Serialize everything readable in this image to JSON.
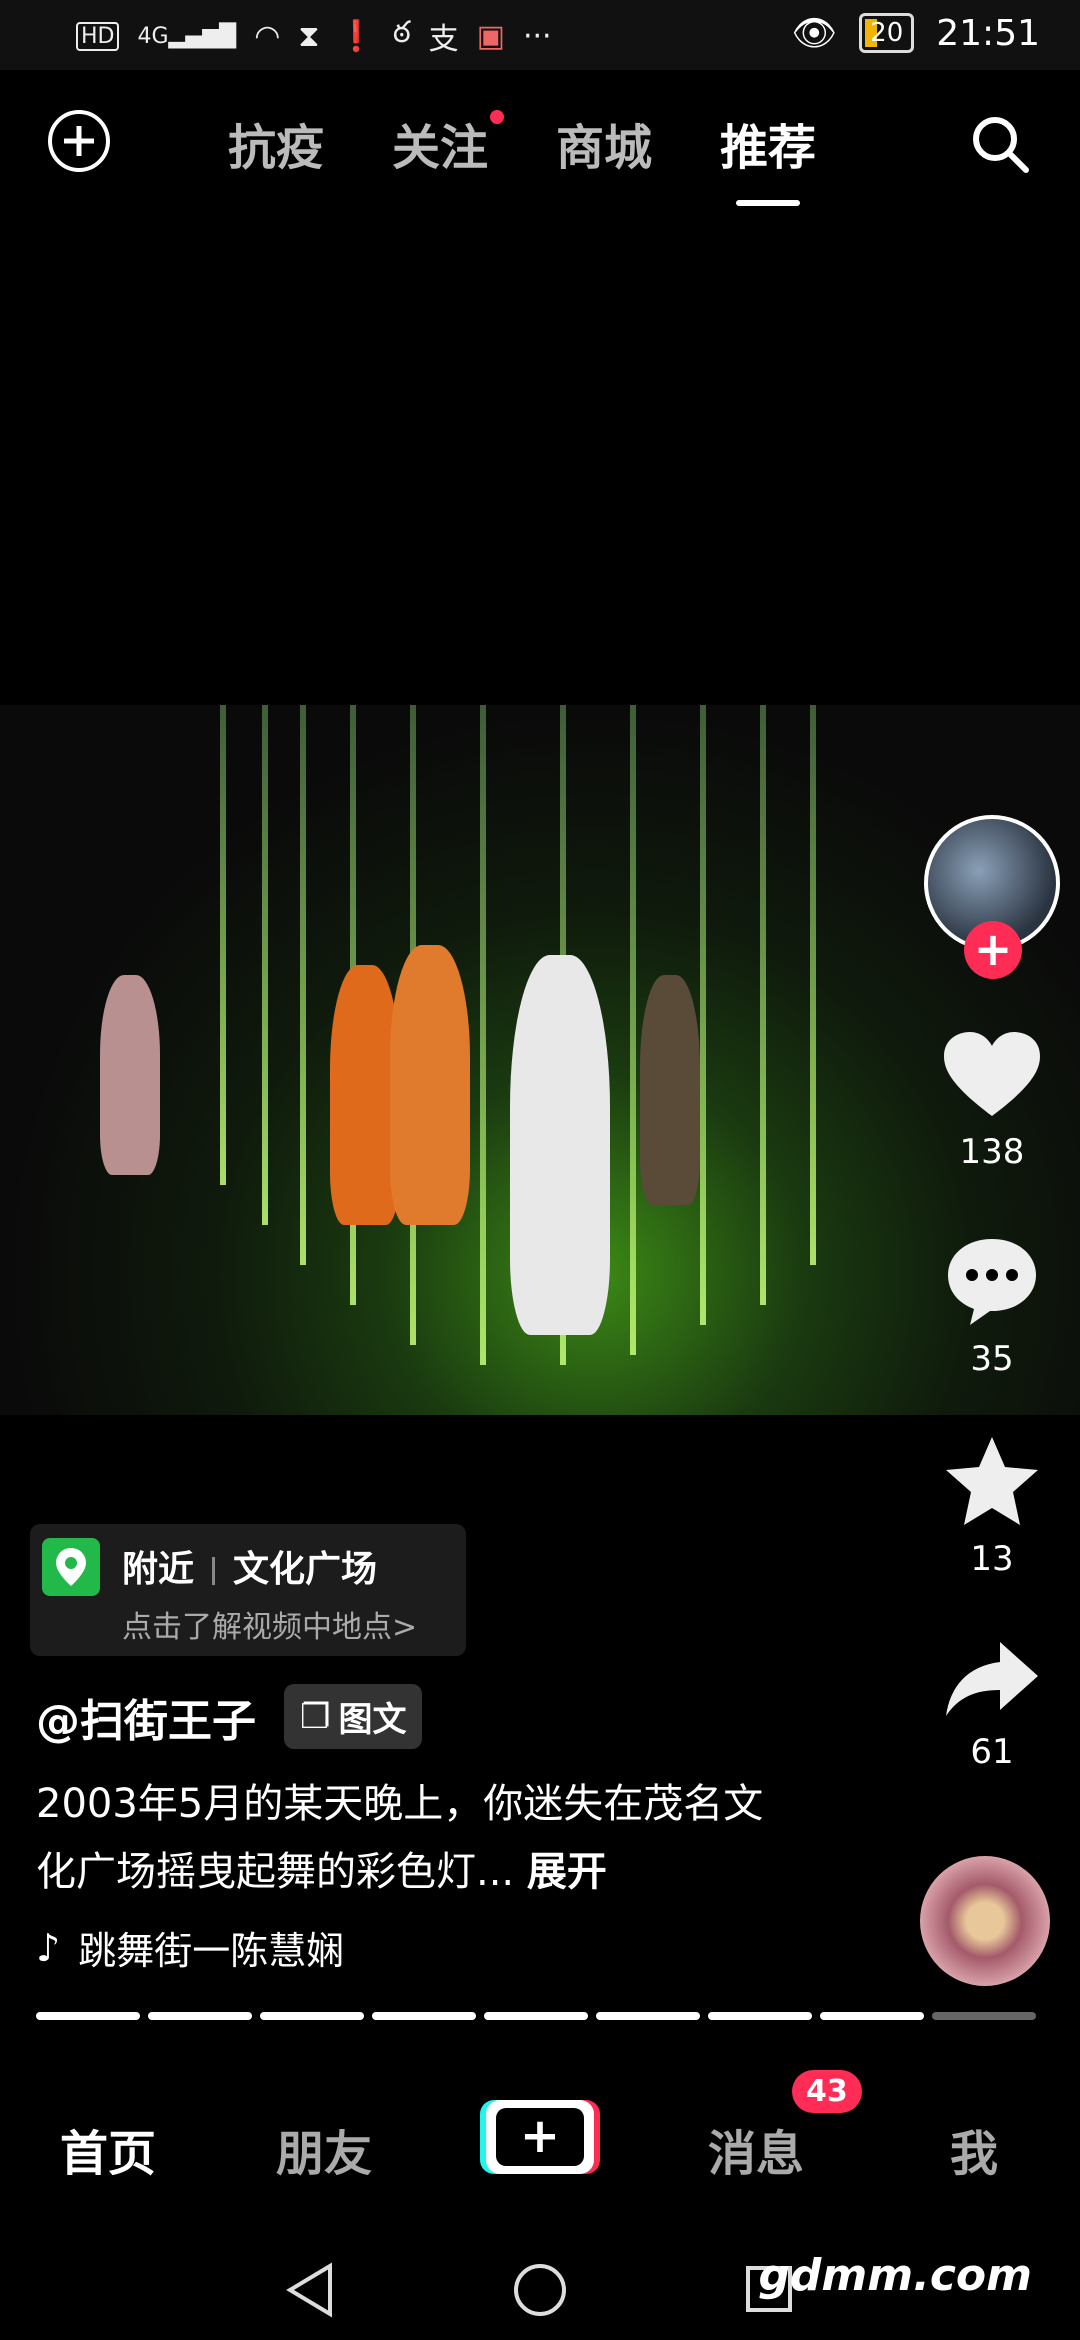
{
  "status_bar": {
    "left_icons": [
      "HD",
      "4G",
      "wifi-icon",
      "hourglass-icon",
      "alert-icon",
      "app-icon",
      "alipay-icon",
      "gift-icon",
      "···"
    ],
    "battery": "20",
    "time": "21:51"
  },
  "top_nav": {
    "tabs": [
      "抗疫",
      "关注",
      "商城",
      "推荐"
    ],
    "active_tab": "推荐"
  },
  "actions": {
    "likes": "138",
    "comments": "35",
    "favorites": "13",
    "shares": "61"
  },
  "location": {
    "nearby": "附近",
    "place": "文化广场",
    "hint": "点击了解视频中地点>"
  },
  "post": {
    "author": "@扫街王子",
    "type_badge": "图文",
    "caption": "2003年5月的某天晚上，你迷失在茂名文化广场摇曳起舞的彩色灯...",
    "expand": "展开",
    "music": "跳舞街一陈慧娴",
    "pages_total": 9,
    "pages_viewed": 8
  },
  "bottom_nav": {
    "home": "首页",
    "friends": "朋友",
    "create": "+",
    "messages": "消息",
    "messages_badge": "43",
    "me": "我"
  },
  "watermark": "gdmm.com"
}
